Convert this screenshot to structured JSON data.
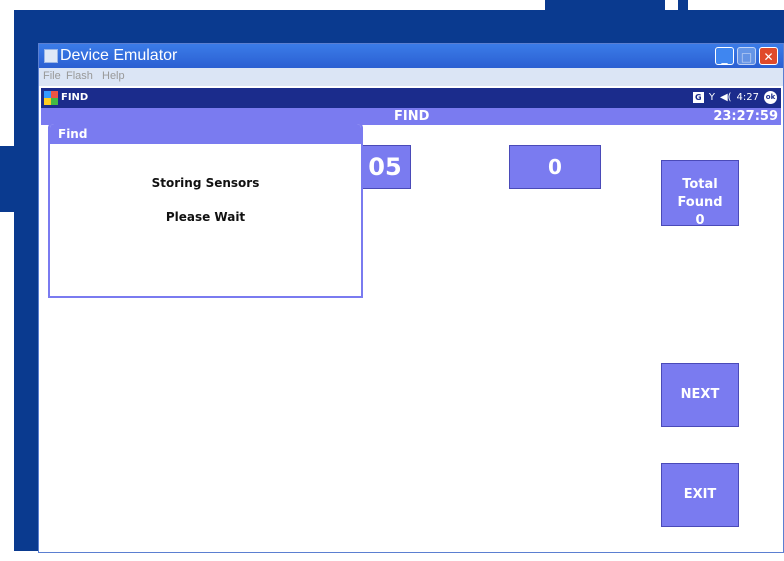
{
  "window": {
    "title": "Device Emulator",
    "menu": [
      "File",
      "Flash",
      "Help"
    ],
    "controls": {
      "minimize": "_",
      "maximize": "□",
      "close": "✕"
    }
  },
  "device": {
    "taskbar": {
      "app_title": "FIND",
      "tray": {
        "icon1": "G",
        "signal": "Y",
        "volume": "◀(",
        "time": "4:27",
        "ok": "ok"
      }
    },
    "header": {
      "title": "FIND",
      "time": "23:27:59"
    },
    "boxes": {
      "code": "05",
      "count": "0",
      "total_found_label": "Total Found",
      "total_found_value": "0",
      "next": "NEXT",
      "exit": "EXIT"
    },
    "dialog": {
      "title": "Find",
      "line1": "Storing Sensors",
      "line2": "Please Wait"
    }
  },
  "colors": {
    "desktop": "#0a3a8f",
    "accent": "#7a7bf0",
    "taskbar": "#1b2c8c"
  },
  "icons": [
    "window-icon",
    "start-flag-icon",
    "g-icon",
    "signal-icon",
    "volume-icon",
    "ok-icon"
  ]
}
